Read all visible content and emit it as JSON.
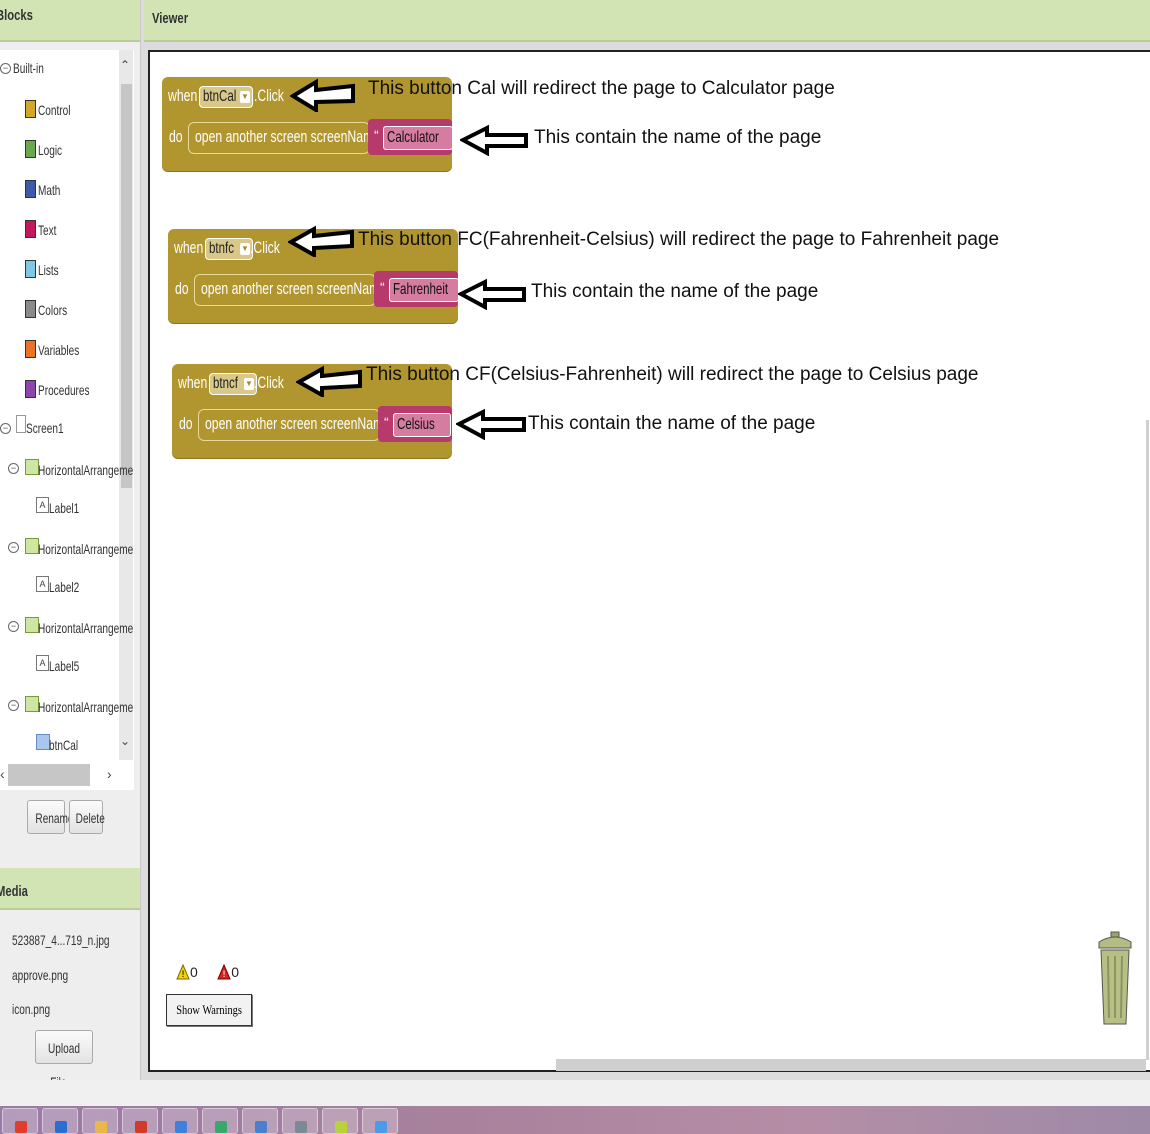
{
  "left_panel": {
    "blocks_header": "Blocks",
    "tree": {
      "built_in": "Built-in",
      "categories": [
        {
          "label": "Control",
          "color": "#d4a52b"
        },
        {
          "label": "Logic",
          "color": "#6aa84f"
        },
        {
          "label": "Math",
          "color": "#3c5ca8"
        },
        {
          "label": "Text",
          "color": "#c2185b"
        },
        {
          "label": "Lists",
          "color": "#7ec8e3"
        },
        {
          "label": "Colors",
          "color": "#8a8a8a"
        },
        {
          "label": "Variables",
          "color": "#e8742a"
        },
        {
          "label": "Procedures",
          "color": "#8e44ad"
        }
      ],
      "screen": "Screen1",
      "components": [
        {
          "label": "HorizontalArrangeme",
          "child": "Label1"
        },
        {
          "label": "HorizontalArrangeme",
          "child": "Label2"
        },
        {
          "label": "HorizontalArrangeme",
          "child": "Label5"
        },
        {
          "label": "HorizontalArrangeme",
          "child": "btnCal"
        }
      ]
    },
    "rename_label": "Rename",
    "delete_label": "Delete",
    "media_header": "Media",
    "media_files": [
      "523887_4...719_n.jpg",
      "approve.png",
      "icon.png"
    ],
    "upload_label": "Upload File ..."
  },
  "viewer": {
    "title": "Viewer",
    "blocks": [
      {
        "when": "when",
        "component": "btnCal",
        "event": ".Click",
        "do": "do",
        "call": "open another screen screenName",
        "screen_name": "Calculator",
        "note_event": "This button Cal will redirect the page to Calculator page",
        "note_name": "This contain the name of the page"
      },
      {
        "when": "when",
        "component": "btnfc",
        "event": ".Click",
        "do": "do",
        "call": "open another screen screenName",
        "screen_name": "Fahrenheit",
        "note_event": "This button FC(Fahrenheit-Celsius) will redirect the page to Fahrenheit page",
        "note_name": "This contain the name of the page"
      },
      {
        "when": "when",
        "component": "btncf",
        "event": ".Click",
        "do": "do",
        "call": "open another screen screenName",
        "screen_name": "Celsius",
        "note_event": "This button CF(Celsius-Fahrenheit) will redirect the page to Celsius page",
        "note_name": "This contain the name of the page"
      }
    ],
    "warnings_count": "0",
    "errors_count": "0",
    "show_warnings_label": "Show Warnings",
    "trash_icon": "trash-can-icon"
  }
}
